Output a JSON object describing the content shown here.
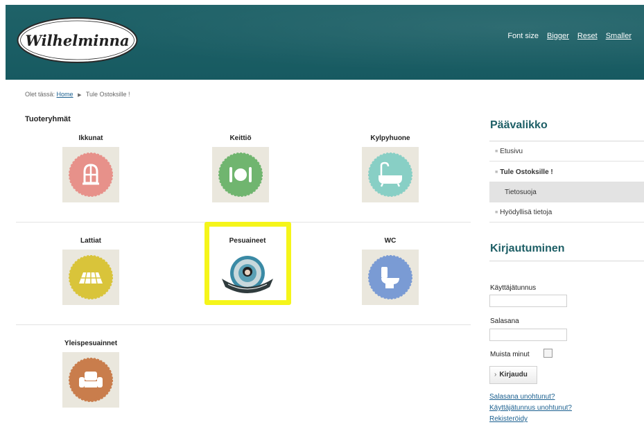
{
  "header": {
    "logo_text": "Wilhelminna",
    "font_size_label": "Font size",
    "font_bigger": "Bigger",
    "font_reset": "Reset",
    "font_smaller": "Smaller"
  },
  "breadcrumb": {
    "prefix": "Olet tässä:",
    "home": "Home",
    "current": "Tule Ostoksille !"
  },
  "categories": {
    "heading": "Tuoteryhmät",
    "items": [
      {
        "label": "Ikkunat",
        "icon": "window-icon",
        "color": "#e7918a"
      },
      {
        "label": "Keittiö",
        "icon": "plate-cutlery-icon",
        "color": "#70b56f"
      },
      {
        "label": "Kylpyhuone",
        "icon": "bathtub-icon",
        "color": "#88cfc5"
      },
      {
        "label": "Lattiat",
        "icon": "floor-icon",
        "color": "#d9c43a"
      },
      {
        "label": "Pesuaineet",
        "icon": "detergent-logo-icon",
        "color": "#2f3b3d"
      },
      {
        "label": "WC",
        "icon": "toilet-icon",
        "color": "#7a9bd4"
      },
      {
        "label": "Yleispesuainnet",
        "icon": "armchair-icon",
        "color": "#c97d4c"
      }
    ]
  },
  "sidebar": {
    "menu_title": "Päävalikko",
    "menu_items": [
      {
        "label": "Etusivu"
      },
      {
        "label": "Tule Ostoksille !"
      },
      {
        "label": "Tietosuoja"
      },
      {
        "label": "Hyödyllisä tietoja"
      }
    ],
    "login_title": "Kirjautuminen",
    "username_label": "Käyttäjätunnus",
    "username_value": "",
    "password_label": "Salasana",
    "password_value": "",
    "remember_label": "Muista minut",
    "login_button": "Kirjaudu",
    "forgot_password": "Salasana unohtunut?",
    "forgot_username": "Käyttäjätunnus unohtunut?",
    "register": "Rekisteröidy"
  },
  "colors": {
    "header_bg": "#1f6268",
    "accent": "#1e5f66",
    "link": "#1a5f8f",
    "highlight": "#f5f51a"
  }
}
